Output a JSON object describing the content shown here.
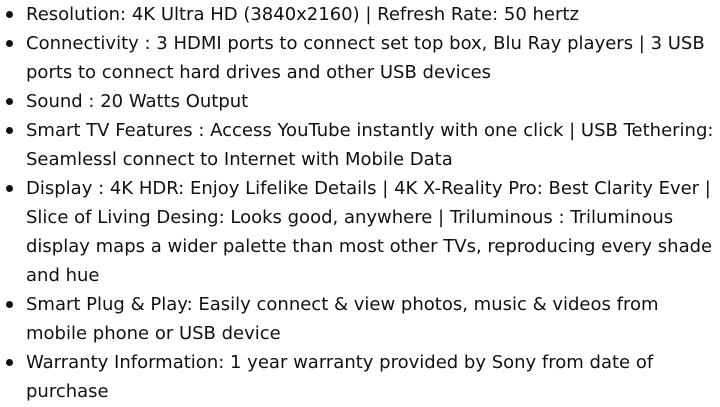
{
  "features": [
    "Resolution: 4K Ultra HD (3840x2160) | Refresh Rate: 50 hertz",
    "Connectivity : 3 HDMI ports to connect set top box, Blu Ray players | 3 USB ports to connect hard drives and other USB devices",
    "Sound : 20 Watts Output",
    "Smart TV Features : Access YouTube instantly with one click | USB Tethering: Seamlessl connect to Internet with Mobile Data",
    "Display : 4K HDR: Enjoy Lifelike Details | 4K X-Reality Pro: Best Clarity Ever | Slice of Living Desing: Looks good, anywhere | Triluminous : Triluminous display maps a wider palette than most other TVs, reproducing every shade and hue",
    "Smart Plug & Play: Easily connect & view photos, music & videos from mobile phone or USB device",
    "Warranty Information: 1 year warranty provided by Sony from date of purchase"
  ]
}
